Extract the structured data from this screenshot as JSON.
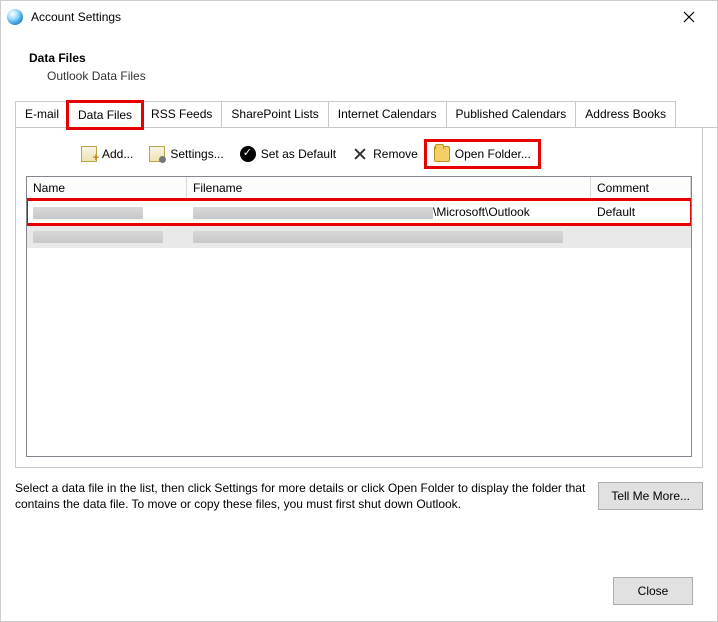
{
  "window": {
    "title": "Account Settings"
  },
  "header": {
    "title": "Data Files",
    "subtitle": "Outlook Data Files"
  },
  "tabs": [
    {
      "label": "E-mail"
    },
    {
      "label": "Data Files"
    },
    {
      "label": "RSS Feeds"
    },
    {
      "label": "SharePoint Lists"
    },
    {
      "label": "Internet Calendars"
    },
    {
      "label": "Published Calendars"
    },
    {
      "label": "Address Books"
    }
  ],
  "toolbar": {
    "add": "Add...",
    "settings": "Settings...",
    "set_default": "Set as Default",
    "remove": "Remove",
    "open_folder": "Open Folder..."
  },
  "grid": {
    "columns": {
      "name": "Name",
      "filename": "Filename",
      "comment": "Comment"
    },
    "rows": [
      {
        "filename_suffix": "\\Microsoft\\Outlook",
        "comment": "Default"
      },
      {
        "filename_suffix": "",
        "comment": ""
      }
    ]
  },
  "hint": "Select a data file in the list, then click Settings for more details or click Open Folder to display the folder that contains the data file. To move or copy these files, you must first shut down Outlook.",
  "buttons": {
    "tell_me_more": "Tell Me More...",
    "close": "Close"
  }
}
